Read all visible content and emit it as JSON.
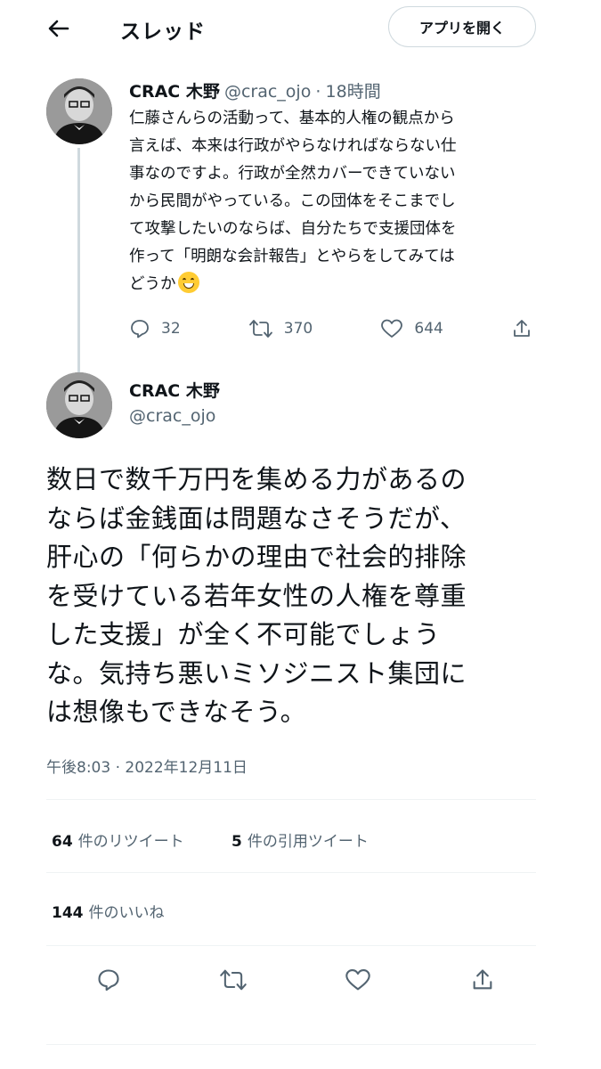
{
  "header": {
    "title": "スレッド",
    "open_app_label": "アプリを開く"
  },
  "reply_tweet": {
    "author_name": "CRAC 木野",
    "author_handle": "@crac_ojo",
    "separator": "·",
    "time_ago": "18時間",
    "text": "仁藤さんらの活動って、基本的人権の観点から\n言えば、本来は行政がやらなければならない仕\n事なのですよ。行政が全然カバーできていない\nから民間がやっている。この団体をそこまでし\nて攻撃したいのならば、自分たちで支援団体を\n作って「明朗な会計報告」とやらをしてみては\nどうか",
    "emoji": "grinning-face-with-smiling-eyes",
    "replies": "32",
    "retweets": "370",
    "likes": "644"
  },
  "main_tweet": {
    "author_name": "CRAC 木野",
    "author_handle": "@crac_ojo",
    "text": "数日で数千万円を集める力があるの\nならば金銭面は問題なさそうだが、\n肝心の「何らかの理由で社会的排除\nを受けている若年女性の人権を尊重\nした支援」が全く不可能でしょう\nな。気持ち悪いミソジニスト集団に\nは想像もできなそう。",
    "timestamp": "午後8:03 · 2022年12月11日",
    "retweet_count": "64",
    "retweet_label": "件のリツイート",
    "quote_count": "5",
    "quote_label": "件の引用ツイート",
    "like_count": "144",
    "like_label": "件のいいね"
  },
  "colors": {
    "text": "#0f1419",
    "secondary": "#536471",
    "border": "#cfd9de",
    "divider": "#eff3f4"
  },
  "icons": [
    "back-arrow-icon",
    "reply-icon",
    "retweet-icon",
    "like-icon",
    "share-icon"
  ]
}
